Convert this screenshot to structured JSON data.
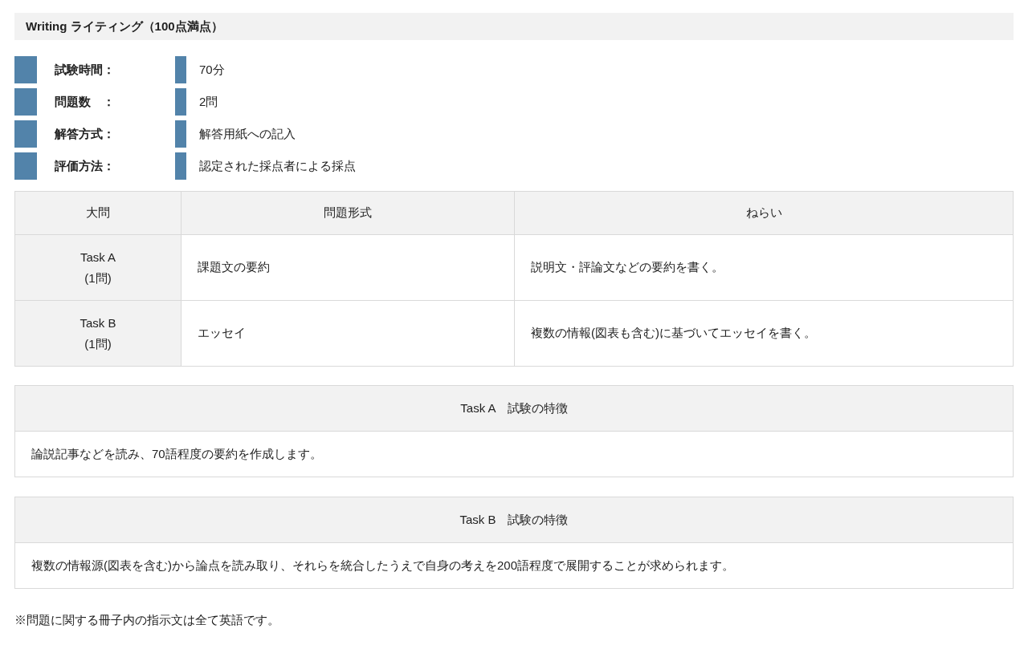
{
  "title": "Writing ライティング（100点満点）",
  "info": [
    {
      "label": "試験時間：",
      "value": "70分"
    },
    {
      "label": "問題数　：",
      "value": "2問"
    },
    {
      "label": "解答方式：",
      "value": "解答用紙への記入"
    },
    {
      "label": "評価方法：",
      "value": "認定された採点者による採点"
    }
  ],
  "table": {
    "columns": [
      "大問",
      "問題形式",
      "ねらい"
    ],
    "rows": [
      {
        "task": "Task A",
        "count": "(1問)",
        "format": "課題文の要約",
        "aim": "説明文・評論文などの要約を書く。"
      },
      {
        "task": "Task B",
        "count": "(1問)",
        "format": "エッセイ",
        "aim": "複数の情報(図表も含む)に基づいてエッセイを書く。"
      }
    ]
  },
  "features": [
    {
      "heading": "Task A　試験の特徴",
      "body": "論説記事などを読み、70語程度の要約を作成します。"
    },
    {
      "heading": "Task B　試験の特徴",
      "body": "複数の情報源(図表を含む)から論点を読み取り、それらを統合したうえで自身の考えを200語程度で展開することが求められます。"
    }
  ],
  "note": "※問題に関する冊子内の指示文は全て英語です。"
}
